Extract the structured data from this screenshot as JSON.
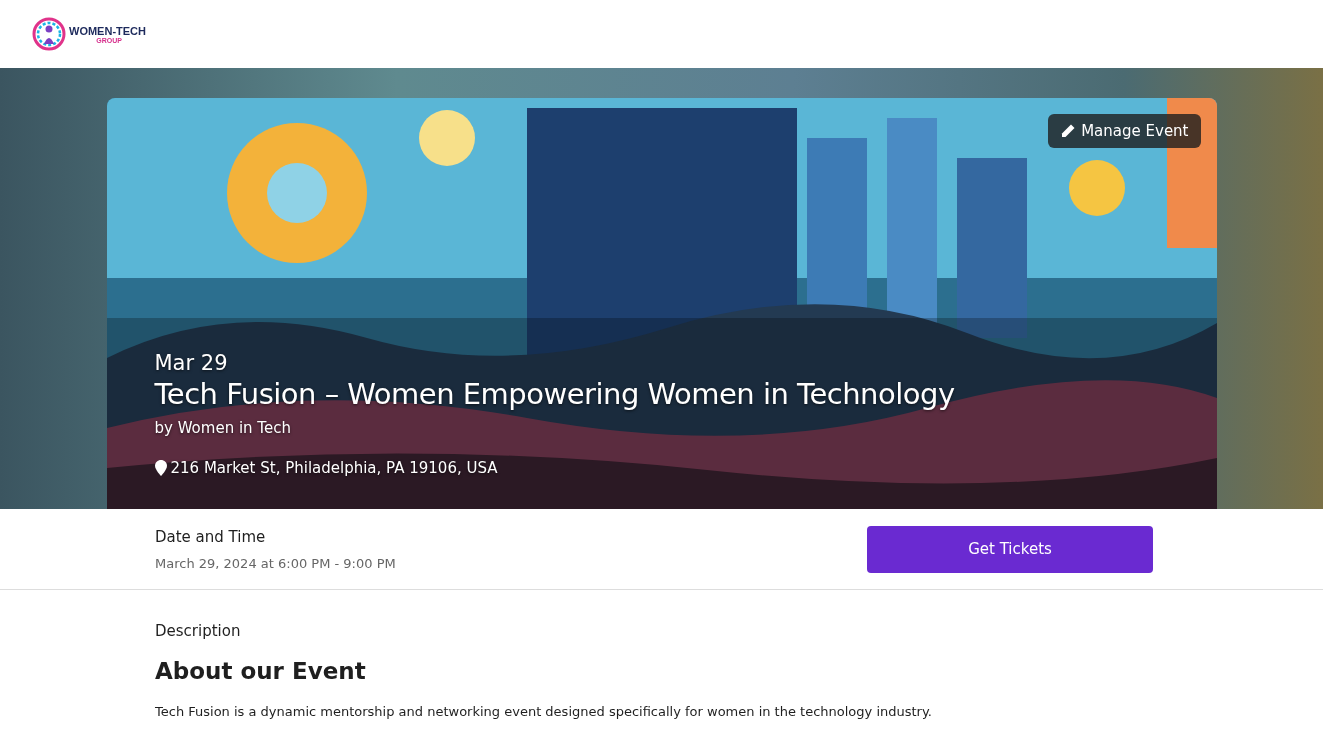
{
  "header": {
    "logo": {
      "name": "WOMEN-TECH",
      "subtitle": "GROUP"
    }
  },
  "hero": {
    "kind": "picture",
    "manage_button": "Manage Event",
    "date": "Mar 29",
    "title": "Tech Fusion – Women Empowering Women in Technology",
    "organizer": "by Women in Tech",
    "address": "216 Market St, Philadelphia, PA 19106, USA"
  },
  "date_time": {
    "label": "Date and Time",
    "value": "March 29, 2024 at 6:00 PM - 9:00 PM"
  },
  "tickets_button": "Get Tickets",
  "description": {
    "label": "Description",
    "heading": "About our Event",
    "text": "Tech Fusion is a dynamic mentorship and networking event designed specifically for women in the technology industry."
  }
}
